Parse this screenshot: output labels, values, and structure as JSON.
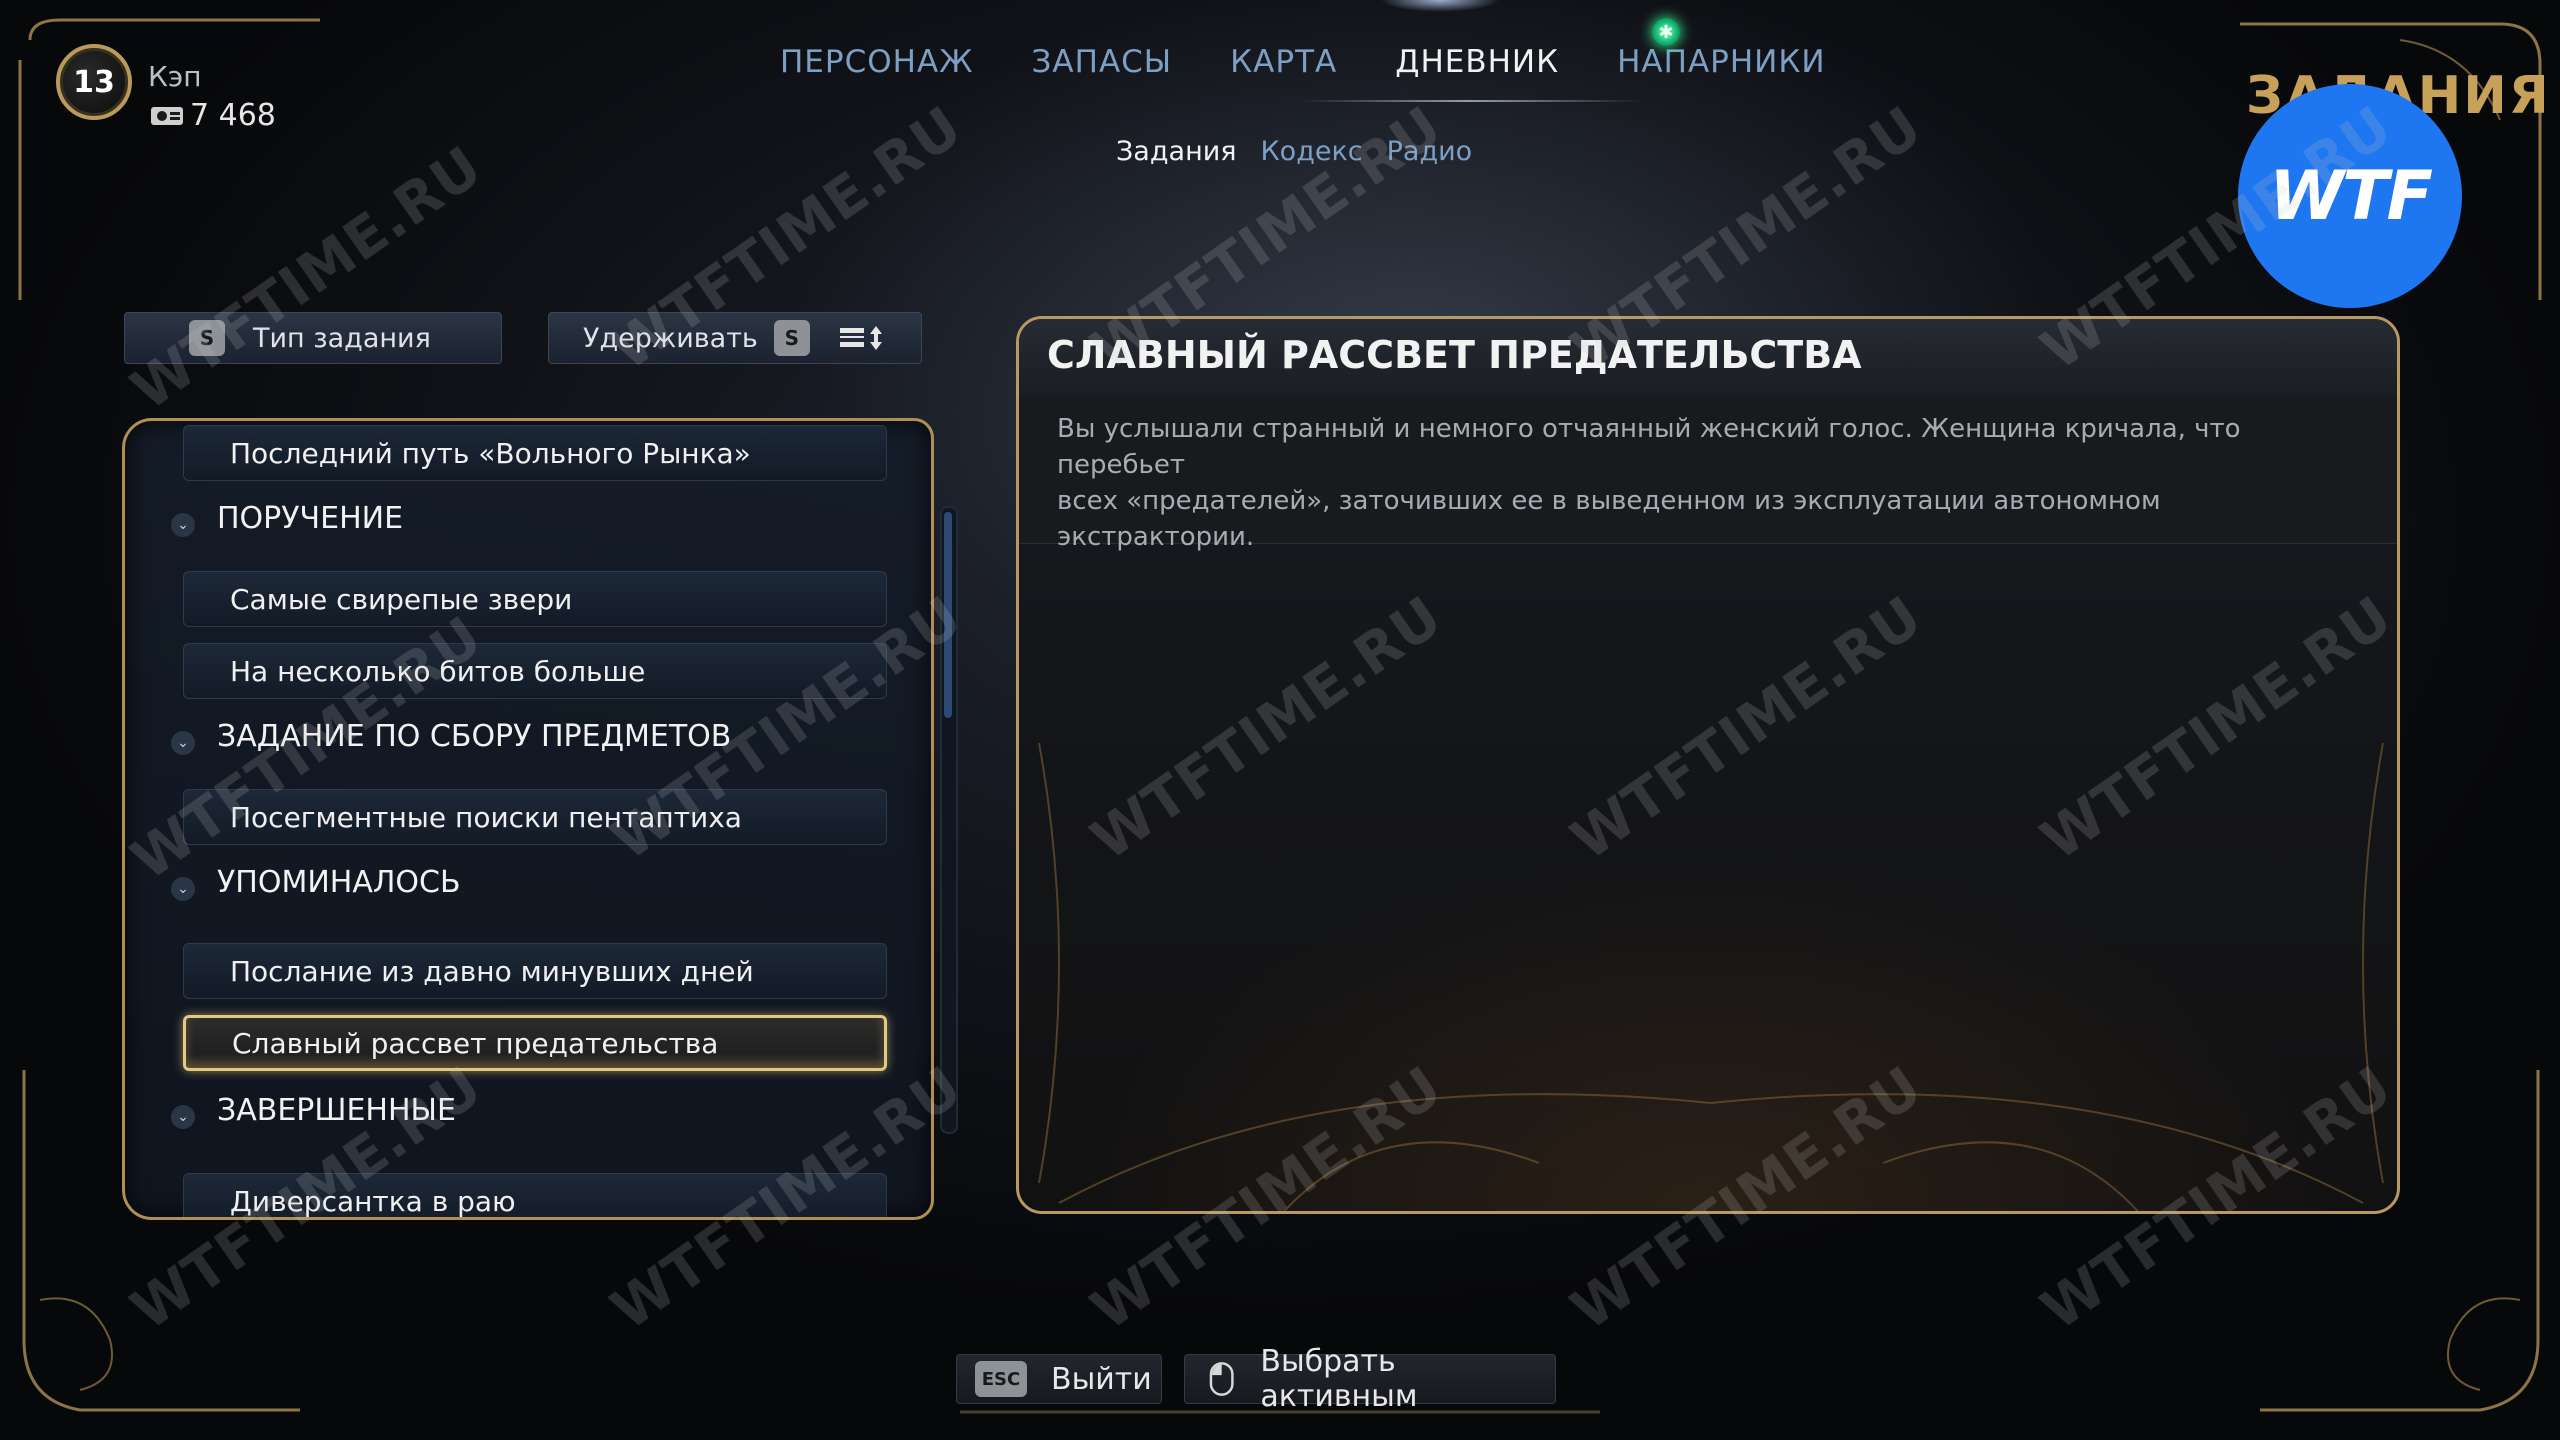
{
  "player": {
    "level": "13",
    "name": "Кэп",
    "currency": "7 468",
    "currency_icon": "bits-icon"
  },
  "nav": {
    "tabs": [
      "ПЕРСОНАЖ",
      "ЗАПАСЫ",
      "КАРТА",
      "ДНЕВНИК",
      "НАПАРНИКИ"
    ],
    "active_tab": "ДНЕВНИК",
    "subtabs": [
      "Задания",
      "Кодекс",
      "Радио"
    ],
    "active_subtab": "Задания"
  },
  "page_title": "ЗАДАНИЯ",
  "logo_text": "WTF",
  "filters": {
    "type_key": "S",
    "type_label": "Тип задания",
    "hold_label": "Удерживать",
    "hold_key": "S"
  },
  "quest_list": {
    "items": [
      {
        "kind": "quest",
        "label": "Последний путь «Вольного Рынка»"
      },
      {
        "kind": "category",
        "label": "ПОРУЧЕНИЕ"
      },
      {
        "kind": "quest",
        "label": "Самые свирепые звери"
      },
      {
        "kind": "quest",
        "label": "На несколько битов больше"
      },
      {
        "kind": "category",
        "label": "ЗАДАНИЕ ПО СБОРУ ПРЕДМЕТОВ"
      },
      {
        "kind": "quest",
        "label": "Посегментные поиски пентаптиха"
      },
      {
        "kind": "category",
        "label": "УПОМИНАЛОСЬ"
      },
      {
        "kind": "quest",
        "label": "Послание из давно минувших дней"
      },
      {
        "kind": "quest",
        "label": "Славный рассвет предательства",
        "selected": true
      },
      {
        "kind": "category",
        "label": "ЗАВЕРШЕННЫЕ"
      },
      {
        "kind": "quest",
        "label": "Диверсантка в раю"
      }
    ]
  },
  "detail": {
    "title": "СЛАВНЫЙ РАССВЕТ ПРЕДАТЕЛЬСТВА",
    "description_line1": "Вы услышали странный и немного отчаянный женский голос. Женщина кричала, что перебьет",
    "description_line2": "всех «предателей», заточивших ее в выведенном из эксплуатации автономном экстрактории."
  },
  "actions": {
    "exit_key": "ESC",
    "exit_label": "Выйти",
    "select_label": "Выбрать активным",
    "select_icon": "mouse-icon"
  },
  "watermark_text": "WTFTIME.RU",
  "colors": {
    "accent_gold": "#b89864",
    "nav_inactive": "#7e9fc4",
    "nav_active": "#f2f2f2",
    "logo_blue": "#1e76f0",
    "notify_green": "#17c07a"
  }
}
